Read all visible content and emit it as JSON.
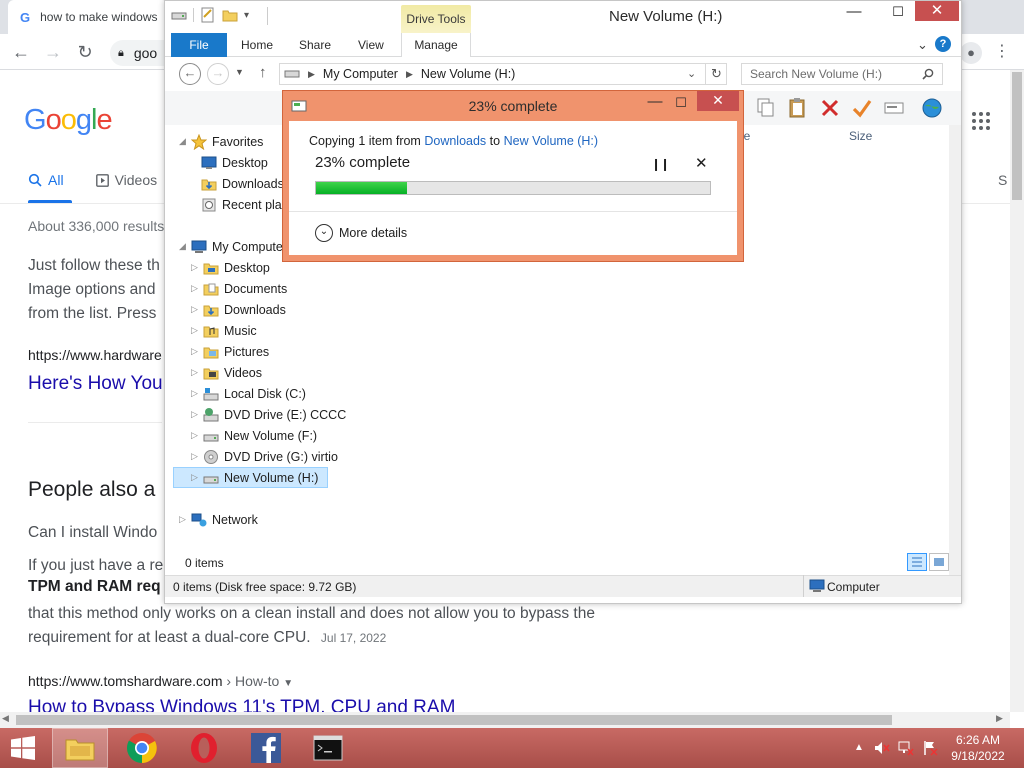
{
  "browser": {
    "tab_title": "how to make windows",
    "omnibox_text": "goo",
    "google_logo": [
      "G",
      "o",
      "o",
      "g",
      "l",
      "e"
    ],
    "tabs": {
      "all": "All",
      "videos": "Videos",
      "cut_right": "S"
    },
    "results_count": "About 336,000 results",
    "snippet_lines": [
      "Just follow these th",
      "Image options and",
      "from the list. Press"
    ],
    "url1": "https://www.hardware",
    "link1": "Here's How You",
    "people_also": "People also a",
    "question1": "Can I install Windo",
    "para_line1": "If you just have a re",
    "para_bold": "TPM and RAM req",
    "para_line3": "that this method only works on a clean install and does not allow you to bypass the",
    "para_line4": "requirement for at least a dual-core CPU.",
    "para_date": "Jul 17, 2022",
    "url2": "https://www.tomshardware.com",
    "url2_path": "› How-to",
    "link2": "How to Bypass Windows 11's TPM, CPU and RAM"
  },
  "explorer": {
    "title": "New Volume (H:)",
    "drive_tools": "Drive Tools",
    "ribbon_tabs": {
      "file": "File",
      "home": "Home",
      "share": "Share",
      "view": "View",
      "manage": "Manage"
    },
    "address": [
      "My Computer",
      "New Volume (H:)"
    ],
    "search_placeholder": "Search New Volume (H:)",
    "columns": {
      "type": "pe",
      "size": "Size"
    },
    "nav": {
      "favorites": "Favorites",
      "fav_items": [
        "Desktop",
        "Downloads",
        "Recent plac"
      ],
      "my_computer": "My Compute",
      "mc_items": [
        "Desktop",
        "Documents",
        "Downloads",
        "Music",
        "Pictures",
        "Videos",
        "Local Disk (C:)",
        "DVD Drive (E:) CCCC",
        "New Volume (F:)",
        "DVD Drive (G:) virtio",
        "New Volume (H:)"
      ],
      "network": "Network"
    },
    "items_count": "0 items",
    "status_left": "0 items (Disk free space: 9.72 GB)",
    "status_right": "Computer"
  },
  "copy_dialog": {
    "title": "23% complete",
    "copying_prefix": "Copying 1 item from",
    "from": "Downloads",
    "to_word": "to",
    "to": "New Volume (H:)",
    "percent_label": "23% complete",
    "progress_fraction": 0.23,
    "more_details": "More details"
  },
  "taskbar": {
    "time": "6:26 AM",
    "date": "9/18/2022"
  },
  "colors": {
    "dialog_frame": "#f0936d",
    "progress_green": "#06b025",
    "taskbar": "#b85f5a",
    "file_tab": "#1979ca"
  }
}
